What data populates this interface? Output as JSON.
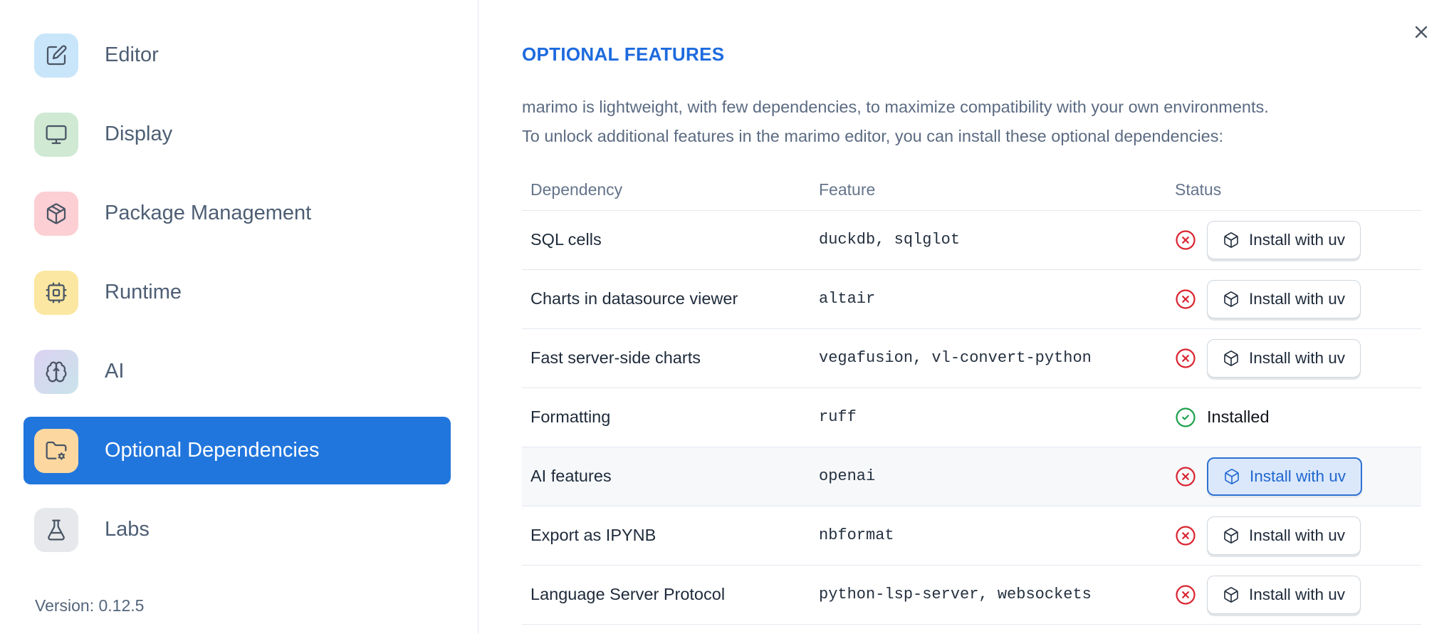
{
  "dialog": {
    "close_icon": "x-icon"
  },
  "sidebar": {
    "items": [
      {
        "label": "Editor",
        "icon": "edit-icon",
        "icon_bg": "#c9e5fa",
        "selected": false
      },
      {
        "label": "Display",
        "icon": "monitor-icon",
        "icon_bg": "#cfe9d2",
        "selected": false
      },
      {
        "label": "Package Management",
        "icon": "package-icon",
        "icon_bg": "#fbcfd4",
        "selected": false
      },
      {
        "label": "Runtime",
        "icon": "cpu-icon",
        "icon_bg": "#fbe7a1",
        "selected": false
      },
      {
        "label": "AI",
        "icon": "brain-icon",
        "icon_bg": "gradient #dcd2f2 to #c9e3ea",
        "selected": false
      },
      {
        "label": "Optional Dependencies",
        "icon": "folder-gear-icon",
        "icon_bg": "#fcd8a0",
        "selected": true
      },
      {
        "label": "Labs",
        "icon": "flask-icon",
        "icon_bg": "#e6e8eb",
        "selected": false
      }
    ],
    "selected_bg_color": "#2176dd",
    "version_label": "Version: 0.12.5"
  },
  "main": {
    "title": "OPTIONAL FEATURES",
    "title_color": "#1d6ade",
    "description_line1": "marimo is lightweight, with few dependencies, to maximize compatibility with your own environments.",
    "description_line2": "To unlock additional features in the marimo editor, you can install these optional dependencies:",
    "table": {
      "columns": [
        "Dependency",
        "Feature",
        "Status"
      ],
      "install_button_label": "Install with uv",
      "installed_label": "Installed",
      "status_error_color": "#d92632",
      "status_ok_color": "#1ea24d",
      "rows": [
        {
          "dependency": "SQL cells",
          "feature": "duckdb, sqlglot",
          "status": "not-installed",
          "highlighted": false
        },
        {
          "dependency": "Charts in datasource viewer",
          "feature": "altair",
          "status": "not-installed",
          "highlighted": false
        },
        {
          "dependency": "Fast server-side charts",
          "feature": "vegafusion, vl-convert-python",
          "status": "not-installed",
          "highlighted": false
        },
        {
          "dependency": "Formatting",
          "feature": "ruff",
          "status": "installed",
          "highlighted": false
        },
        {
          "dependency": "AI features",
          "feature": "openai",
          "status": "not-installed",
          "highlighted": true,
          "button_focused": true
        },
        {
          "dependency": "Export as IPYNB",
          "feature": "nbformat",
          "status": "not-installed",
          "highlighted": false
        },
        {
          "dependency": "Language Server Protocol",
          "feature": "python-lsp-server, websockets",
          "status": "not-installed",
          "highlighted": false
        }
      ]
    }
  }
}
